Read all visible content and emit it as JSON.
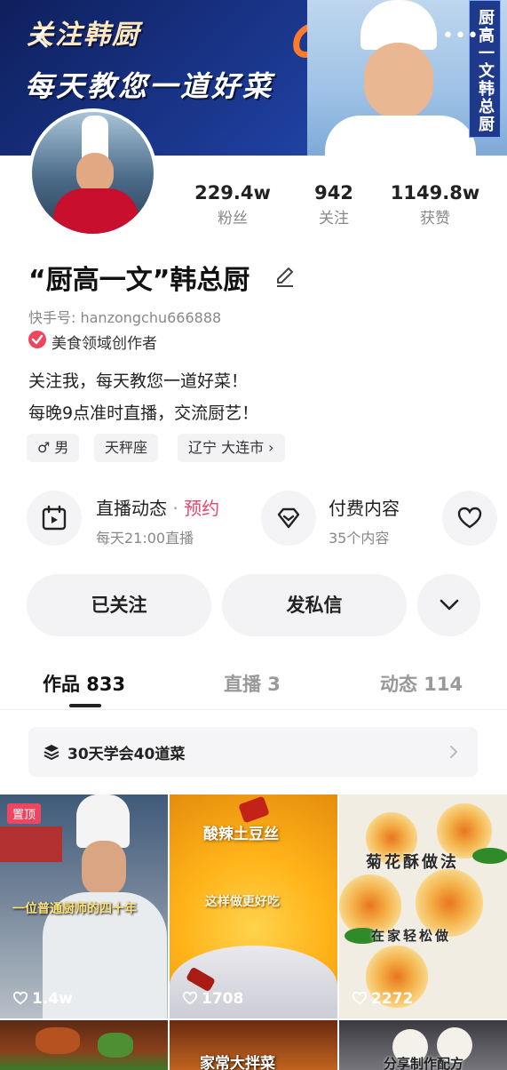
{
  "banner": {
    "line1": "关注韩厨",
    "line2": "每天教您一道好菜",
    "vertical_tag": "厨高一文韩总厨",
    "more_label": "•••"
  },
  "profile": {
    "name": "“厨高一文”韩总厨",
    "account_id": "快手号: hanzongchu666888",
    "creator_label": "美食领域创作者",
    "bio": [
      "关注我，每天教您一道好菜！",
      "每晚9点准时直播，交流厨艺！"
    ],
    "tags": [
      {
        "label": "♂ 男"
      },
      {
        "label": "天秤座"
      },
      {
        "label": "辽宁 大连市 ›"
      }
    ]
  },
  "stats": [
    {
      "value": "229.4w",
      "label": "粉丝"
    },
    {
      "value": "942",
      "label": "关注"
    },
    {
      "value": "1149.8w",
      "label": "获赞"
    }
  ],
  "features": {
    "live": {
      "title": "直播动态",
      "sep": " · ",
      "accent": "预约",
      "sub": "每天21:00直播"
    },
    "paid": {
      "title": "付费内容",
      "sub": "35个内容"
    }
  },
  "actions": {
    "follow": "已关注",
    "message": "发私信"
  },
  "tabs": [
    {
      "label": "作品 833",
      "active": true
    },
    {
      "label": "直播 3",
      "active": false
    },
    {
      "label": "动态 114",
      "active": false
    }
  ],
  "collection": {
    "label": "30天学会40道菜"
  },
  "videos": [
    {
      "pinned": "置顶",
      "caption": "一位普通厨师的四十年",
      "likes": "1.4w"
    },
    {
      "caption": "酸辣土豆丝",
      "caption2": "这样做更好吃",
      "likes": "1708"
    },
    {
      "caption": "菊花酥做法",
      "caption2": "在家轻松做",
      "likes": "2272"
    },
    {
      "caption": "",
      "likes": ""
    },
    {
      "caption": "家常大拌菜",
      "likes": ""
    },
    {
      "caption": "分享制作配方",
      "likes": ""
    }
  ],
  "colors": {
    "accent": "#e8456b",
    "badge": "#f0455f",
    "banner": "#1c3a94"
  }
}
